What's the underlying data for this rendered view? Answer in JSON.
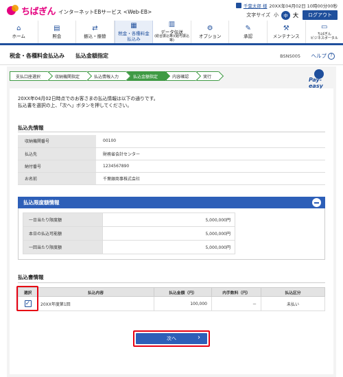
{
  "header": {
    "logo_text": "ちばぎん",
    "service_name": "インターネットEBサービス <Web-EB>",
    "user_name": "千葉太郎 様",
    "login_datetime": "20XX年04月02日 10時00分00秒",
    "font_size_label": "文字サイズ",
    "font_small": "小",
    "font_medium": "中",
    "font_large": "大",
    "logout_label": "ログアウト"
  },
  "nav": [
    {
      "label": "ホーム",
      "sub": "",
      "icon": "home-icon",
      "glyph": "⌂"
    },
    {
      "label": "照会",
      "sub": "",
      "icon": "inquiry-icon",
      "glyph": "▤"
    },
    {
      "label": "振込・振替",
      "sub": "",
      "icon": "transfer-icon",
      "glyph": "⇄"
    },
    {
      "label": "税金・各種料金",
      "sub": "払込み",
      "icon": "tax-payment-icon",
      "glyph": "▦"
    },
    {
      "label": "データ伝送",
      "sub": "(総合振込等)(給与振込等)",
      "icon": "data-transfer-icon",
      "glyph": "▥"
    },
    {
      "label": "オプション",
      "sub": "",
      "icon": "option-icon",
      "glyph": "⚙"
    },
    {
      "label": "承認",
      "sub": "",
      "icon": "approval-icon",
      "glyph": "✎"
    },
    {
      "label": "メンテナンス",
      "sub": "",
      "icon": "maintenance-icon",
      "glyph": "⚒"
    },
    {
      "label": "ちばぎん",
      "sub": "ビジネスポータル",
      "icon": "portal-icon",
      "glyph": "▭"
    }
  ],
  "page": {
    "title": "税金・各種料金払込み",
    "subtitle": "払込金額指定",
    "screen_id": "BSNS005",
    "help_label": "ヘルプ",
    "help_icon": "?"
  },
  "steps": [
    "支払口座選択",
    "収納機関指定",
    "払込情報入力",
    "払込金額指定",
    "内容確認",
    "実行"
  ],
  "payeasy_label": "Pay-easy",
  "intro": {
    "line1": "20XX年04月02日時点でのお客さまの払込情報は以下の通りです。",
    "line2": "払込書を選択の上、「次へ」ボタンを押してください。"
  },
  "payee_info": {
    "title": "払込先情報",
    "rows": [
      {
        "label": "収納機関番号",
        "value": "00100"
      },
      {
        "label": "払込先",
        "value": "財務省会計センター"
      },
      {
        "label": "納付番号",
        "value": "1234567890"
      },
      {
        "label": "お名前",
        "value": "千葉銀商事株式会社"
      }
    ]
  },
  "limits": {
    "title": "払込限度額情報",
    "rows": [
      {
        "label": "一日当たり限度額",
        "value": "5,000,000円"
      },
      {
        "label": "本日の払込可能額",
        "value": "5,000,000円"
      },
      {
        "label": "一回当たり限度額",
        "value": "5,000,000円"
      }
    ]
  },
  "bill_info": {
    "title": "払込書情報",
    "headers": [
      "選択",
      "払込内容",
      "払込金額（円）",
      "内手数料（円）",
      "払込区分"
    ],
    "rows": [
      {
        "selected": true,
        "content": "20XX年度第1回",
        "amount": "100,000",
        "fee": "－",
        "status": "未払い"
      }
    ]
  },
  "next_button": {
    "label": "次へ"
  }
}
